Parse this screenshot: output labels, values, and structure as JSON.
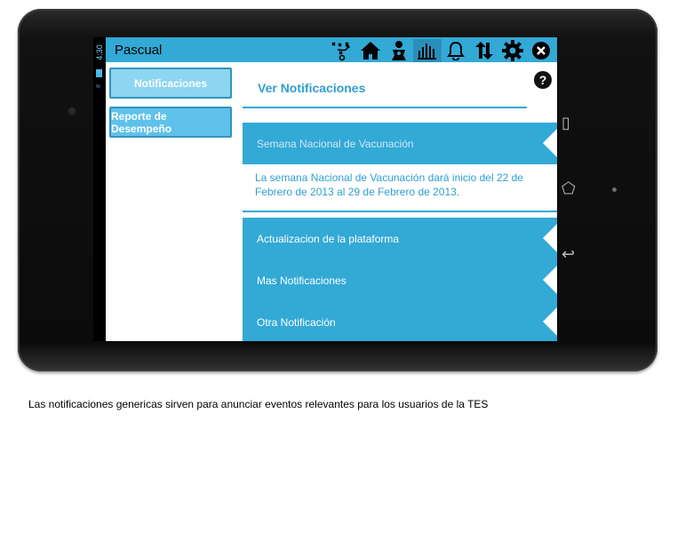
{
  "status": {
    "time": "4:30"
  },
  "app": {
    "user_name": "Pascual"
  },
  "toolbar": {
    "icons": [
      "strategy-icon",
      "home-icon",
      "baby-icon",
      "chart-icon",
      "bell-icon",
      "sync-icon",
      "gear-icon",
      "close-icon"
    ],
    "active_icon": "chart-icon"
  },
  "sidebar": {
    "items": [
      {
        "label": "Notificaciones"
      },
      {
        "label": "Reporte de Desempeño"
      }
    ]
  },
  "main": {
    "heading": "Ver Notificaciones",
    "help_symbol": "?",
    "notifications": [
      {
        "label": "Semana Nacional de Vacunación",
        "expanded": true,
        "detail": "La semana Nacional de Vacunación dará inicio del 22 de Febrero de 2013 al 29 de Febrero de 2013."
      },
      {
        "label": "Actualizacion de la plataforma"
      },
      {
        "label": "Mas Notificaciones"
      },
      {
        "label": "Otra Notificación"
      }
    ]
  },
  "caption": "Las notificaciones genericas sirven para anunciar eventos relevantes para los usuarios de la TES",
  "colors": {
    "accent": "#33a9d6",
    "sidebar_active": "#8dd6f1",
    "sidebar_inactive": "#5fc1ea"
  }
}
